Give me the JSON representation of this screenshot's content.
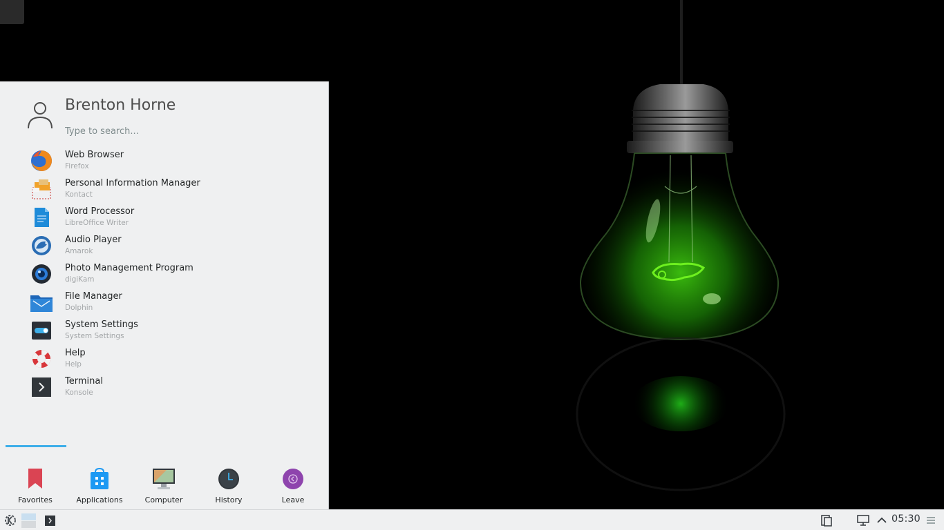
{
  "launcher": {
    "user_name": "Brenton Horne",
    "search_placeholder": "Type to search...",
    "favorites": [
      {
        "title": "Web Browser",
        "subtitle": "Firefox",
        "icon": "firefox-icon"
      },
      {
        "title": "Personal Information Manager",
        "subtitle": "Kontact",
        "icon": "kontact-icon"
      },
      {
        "title": "Word Processor",
        "subtitle": "LibreOffice Writer",
        "icon": "writer-icon"
      },
      {
        "title": "Audio Player",
        "subtitle": "Amarok",
        "icon": "amarok-icon"
      },
      {
        "title": "Photo Management Program",
        "subtitle": "digiKam",
        "icon": "digikam-icon"
      },
      {
        "title": "File Manager",
        "subtitle": "Dolphin",
        "icon": "dolphin-icon"
      },
      {
        "title": "System Settings",
        "subtitle": "System Settings",
        "icon": "settings-icon"
      },
      {
        "title": "Help",
        "subtitle": "Help",
        "icon": "help-icon"
      },
      {
        "title": "Terminal",
        "subtitle": "Konsole",
        "icon": "terminal-icon"
      }
    ],
    "tabs": [
      {
        "label": "Favorites",
        "icon": "bookmark-icon",
        "active": true
      },
      {
        "label": "Applications",
        "icon": "applications-icon",
        "active": false
      },
      {
        "label": "Computer",
        "icon": "computer-icon",
        "active": false
      },
      {
        "label": "History",
        "icon": "history-icon",
        "active": false
      },
      {
        "label": "Leave",
        "icon": "leave-icon",
        "active": false
      }
    ]
  },
  "panel": {
    "clock": "05:30"
  },
  "colors": {
    "accent": "#3daee9",
    "launcher_bg": "#eff0f1",
    "bulb_green": "#6ef01f"
  }
}
